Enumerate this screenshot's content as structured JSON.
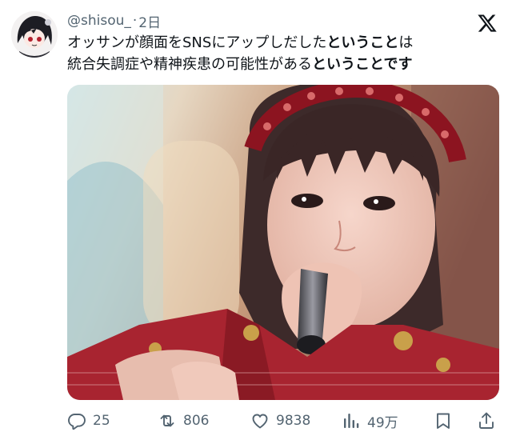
{
  "tweet": {
    "handle": "@shisou_",
    "separator": "·",
    "time": "2日",
    "text_line1_a": "オッサンが顔面をSNSにアップしだした",
    "text_line1_b": "ということ",
    "text_line1_c": "は",
    "text_line2_a": "統合失調症や精神疾患の可能性がある",
    "text_line2_b": "ということです"
  },
  "actions": {
    "replies": "25",
    "reposts": "806",
    "likes": "9838",
    "views": "49万"
  },
  "icons": {
    "logo": "x-logo-icon",
    "reply": "reply-icon",
    "repost": "repost-icon",
    "like": "heart-icon",
    "views": "views-bar-chart-icon",
    "bookmark": "bookmark-icon",
    "share": "share-icon"
  },
  "colors": {
    "text": "#0f1419",
    "muted": "#536471",
    "costume_red": "#a82430"
  }
}
